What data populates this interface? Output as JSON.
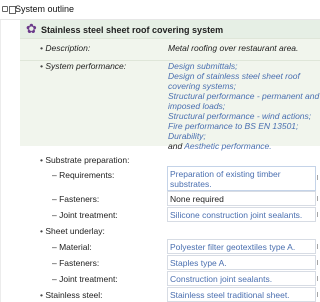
{
  "header": {
    "title": "System outline"
  },
  "system": {
    "title": "Stainless steel sheet roof covering system"
  },
  "rows": {
    "description": {
      "label": "Description:",
      "value": "Metal roofing over restaurant area."
    },
    "performance": {
      "label": "System performance:",
      "lines": [
        "Design submittals;",
        "Design of stainless steel sheet roof",
        "covering systems;",
        "Structural performance - permanent and",
        "imposed loads;",
        "Structural performance - wind actions;",
        "Fire performance to BS EN 13501;",
        "Durability;"
      ],
      "last_prefix": "and ",
      "last_link": "Aesthetic performance."
    },
    "substrate": {
      "label": "Substrate preparation:",
      "requirements": {
        "label": "– Requirements:",
        "value_line1": "Preparation of existing timber",
        "value_line2": "substrates."
      },
      "fasteners": {
        "label": "– Fasteners:",
        "value": "None required"
      },
      "joint": {
        "label": "– Joint treatment:",
        "value": "Silicone construction joint sealants."
      }
    },
    "underlay": {
      "label": "Sheet underlay:",
      "material": {
        "label": "– Material:",
        "value": "Polyester filter geotextiles type A."
      },
      "fasteners": {
        "label": "– Fasteners:",
        "value": "Staples type A."
      },
      "joint": {
        "label": "– Joint treatment:",
        "value": "Construction joint sealants."
      }
    },
    "stainless": {
      "label": "Stainless steel:",
      "value": "Stainless steel traditional sheet."
    }
  }
}
